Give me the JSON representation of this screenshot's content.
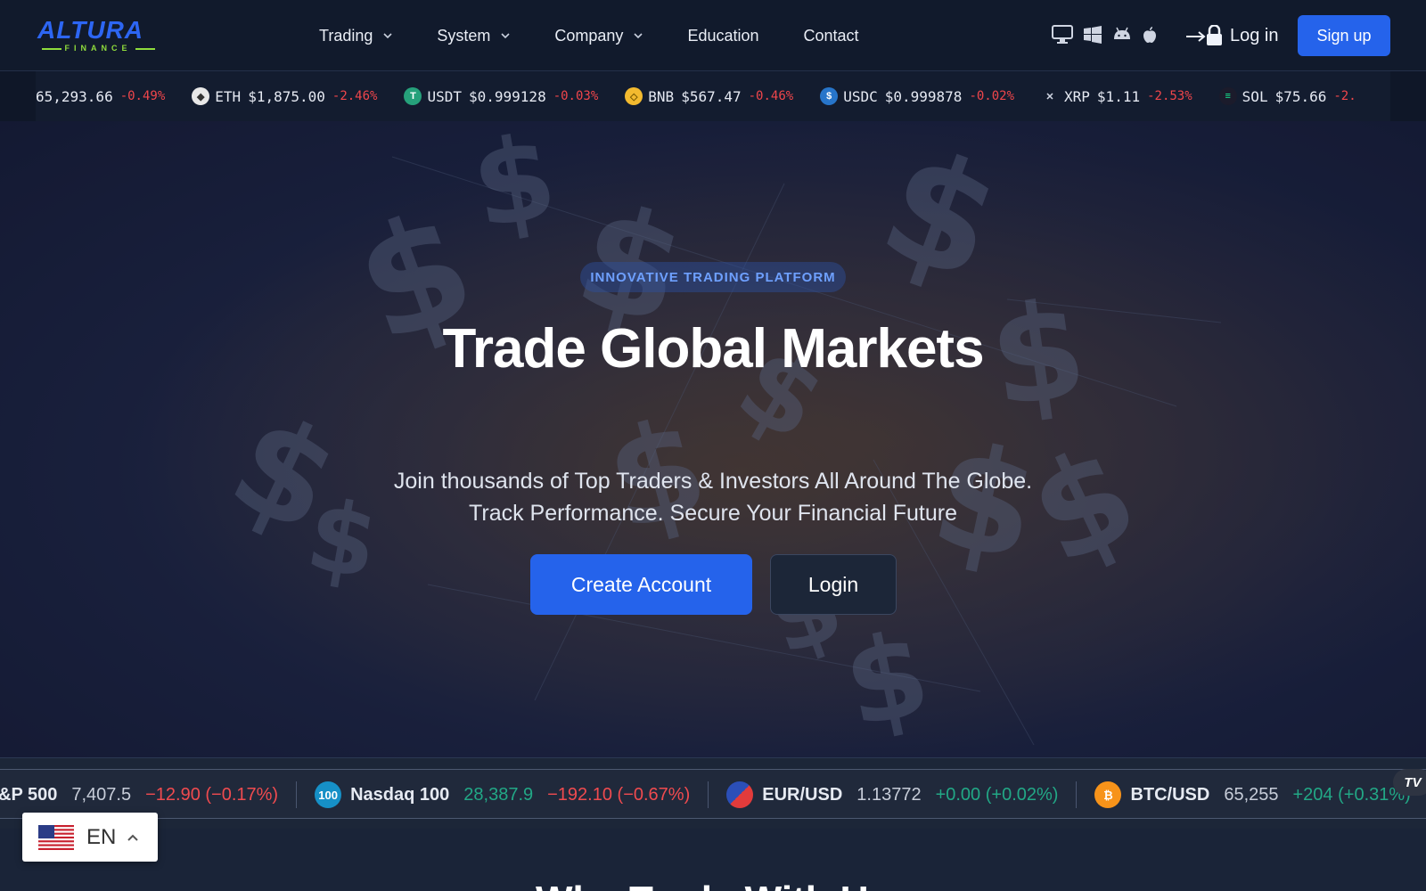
{
  "nav": {
    "logo_main": "ALTURA",
    "logo_sub": "FINANCE",
    "menu": [
      {
        "label": "Trading",
        "dropdown": true
      },
      {
        "label": "System",
        "dropdown": true
      },
      {
        "label": "Company",
        "dropdown": true
      },
      {
        "label": "Education",
        "dropdown": false
      },
      {
        "label": "Contact",
        "dropdown": false
      }
    ],
    "platform_icons": [
      "desktop-icon",
      "windows-icon",
      "android-icon",
      "apple-icon"
    ],
    "login_label": "Log in",
    "signup_label": "Sign up"
  },
  "crypto_ticker": [
    {
      "symbol": "",
      "price": "65,293.66",
      "change": "-0.49%",
      "icon": "btc",
      "color": "#f7931a"
    },
    {
      "symbol": "ETH",
      "price": "$1,875.00",
      "change": "-2.46%",
      "icon": "eth",
      "color": "#e8e8e8"
    },
    {
      "symbol": "USDT",
      "price": "$0.999128",
      "change": "-0.03%",
      "icon": "usdt",
      "color": "#26a17b"
    },
    {
      "symbol": "BNB",
      "price": "$567.47",
      "change": "-0.46%",
      "icon": "bnb",
      "color": "#f3ba2f"
    },
    {
      "symbol": "USDC",
      "price": "$0.999878",
      "change": "-0.02%",
      "icon": "usdc",
      "color": "#2775ca"
    },
    {
      "symbol": "XRP",
      "price": "$1.11",
      "change": "-2.53%",
      "icon": "xrp",
      "color": "#23292f"
    },
    {
      "symbol": "SOL",
      "price": "$75.66",
      "change": "-2.",
      "icon": "sol",
      "color": "#14f195"
    }
  ],
  "hero": {
    "badge": "INNOVATIVE TRADING PLATFORM",
    "title": "Trade Global Markets",
    "subtitle_line1": "Join thousands of Top Traders & Investors All Around The Globe.",
    "subtitle_line2": "Track Performance. Secure Your Financial Future",
    "primary_button": "Create Account",
    "secondary_button": "Login"
  },
  "market_ticker": [
    {
      "name": "&P 500",
      "price": "7,407.5",
      "change": "−12.90 (−0.17%)",
      "direction": "down",
      "price_color": "neutral",
      "icon": ""
    },
    {
      "name": "Nasdaq 100",
      "price": "28,387.9",
      "change": "−192.10 (−0.67%)",
      "direction": "down",
      "price_color": "up",
      "icon": "100"
    },
    {
      "name": "EUR/USD",
      "price": "1.13772",
      "change": "+0.00 (+0.02%)",
      "direction": "up",
      "price_color": "neutral",
      "icon": "flags"
    },
    {
      "name": "BTC/USD",
      "price": "65,255",
      "change": "+204 (+0.31%)",
      "direction": "up",
      "price_color": "neutral",
      "icon": "₿"
    }
  ],
  "tradingview_badge": "TV",
  "next_section_title": "Why Trade With Us",
  "language": {
    "code": "EN",
    "flag": "us-flag-icon"
  }
}
